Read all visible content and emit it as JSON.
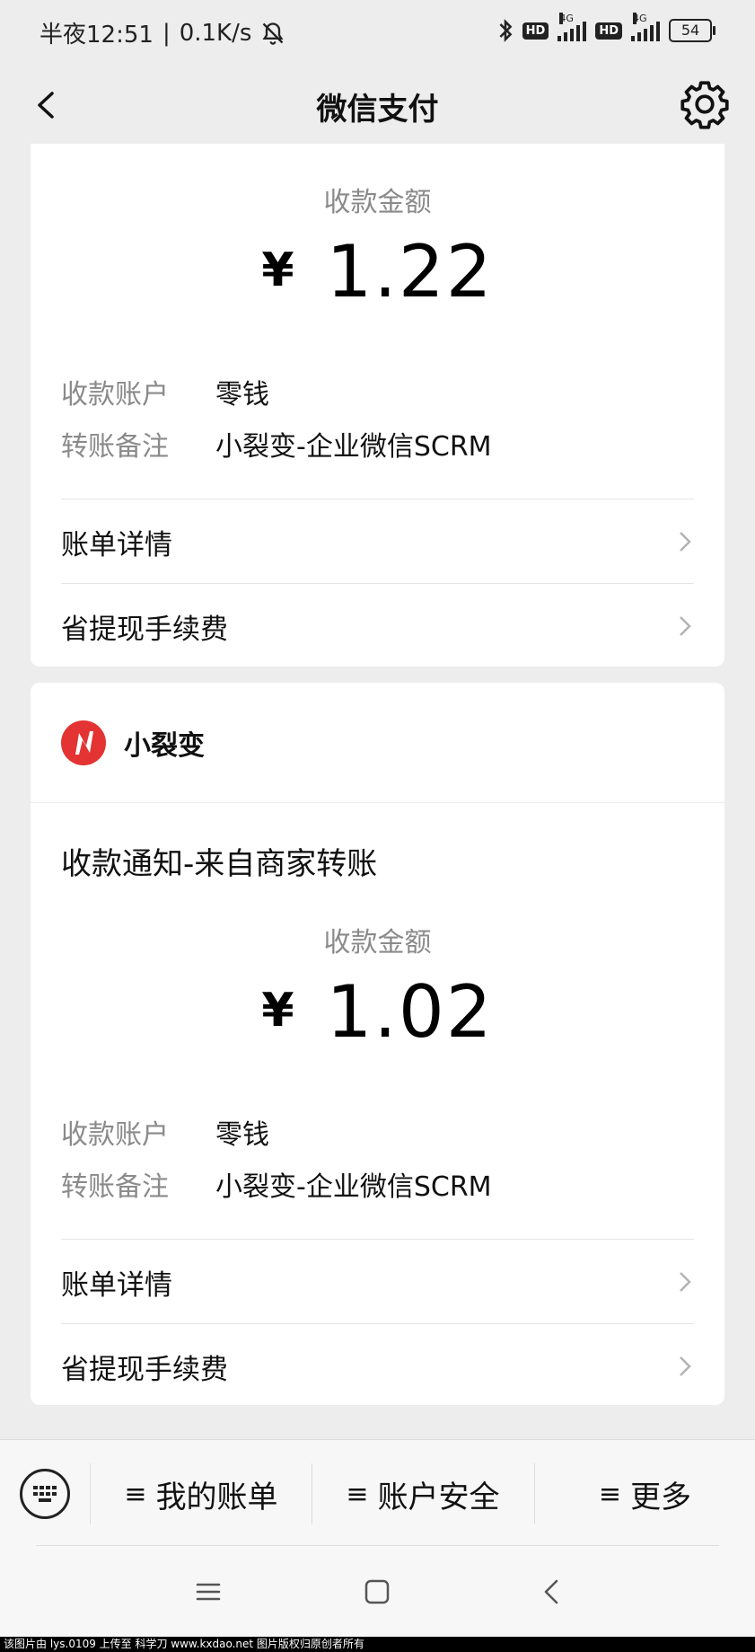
{
  "status_bar": {
    "time": "半夜12:51",
    "separator": "|",
    "speed": "0.1K/s",
    "hd1": "HD",
    "net1": "4G",
    "hd2": "HD",
    "net2": "4G",
    "battery": "54"
  },
  "nav": {
    "title": "微信支付",
    "back_icon": "chevron-left-icon",
    "settings_icon": "gear-icon"
  },
  "card1": {
    "amount_label": "收款金额",
    "currency": "¥",
    "amount": "1.22",
    "account_key": "收款账户",
    "account_value": "零钱",
    "note_key": "转账备注",
    "note_value": "小裂变-企业微信SCRM",
    "row1": "账单详情",
    "row2": "省提现手续费"
  },
  "card2": {
    "brand": "小裂变",
    "notice_title": "收款通知-来自商家转账",
    "amount_label": "收款金额",
    "currency": "¥",
    "amount": "1.02",
    "account_key": "收款账户",
    "account_value": "零钱",
    "note_key": "转账备注",
    "note_value": "小裂变-企业微信SCRM",
    "row1": "账单详情",
    "row2": "省提现手续费"
  },
  "menu": {
    "ham": "≡",
    "item1": "我的账单",
    "item2": "账户安全",
    "item3": "更多",
    "keyboard_icon": "keyboard-icon"
  },
  "watermark": "该图片由 lys.0109 上传至 科学刀 www.kxdao.net 图片版权归原创者所有",
  "colors": {
    "background": "#ededed",
    "card": "#ffffff",
    "logo_red": "#e33333",
    "muted_text": "#8a8a8a"
  }
}
